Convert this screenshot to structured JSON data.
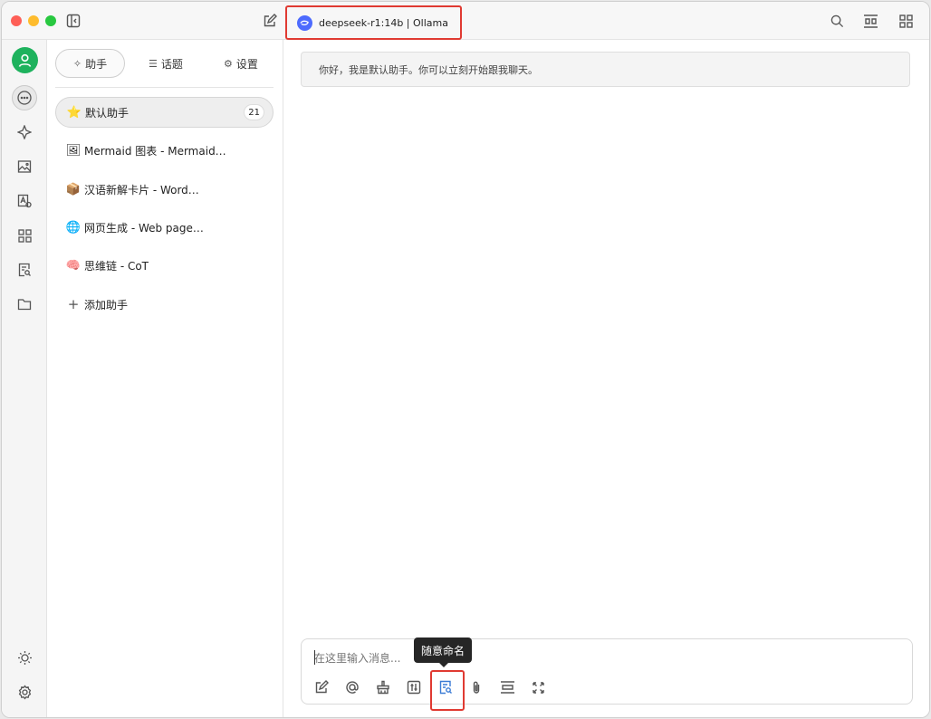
{
  "titlebar": {
    "model_label": "deepseek-r1:14b | Ollama",
    "icons": [
      "sidebar-toggle-icon",
      "new-chat-icon",
      "search-icon",
      "layout-icon",
      "apps-icon"
    ]
  },
  "rail": {
    "items": [
      "user-avatar",
      "chat-icon",
      "sparkle-icon",
      "image-icon",
      "translate-icon",
      "apps-icon",
      "document-search-icon",
      "folder-icon",
      "theme-icon",
      "settings-icon"
    ]
  },
  "panel": {
    "tabs": [
      {
        "label": "助手",
        "icon": "✧"
      },
      {
        "label": "话题",
        "icon": "☰"
      },
      {
        "label": "设置",
        "icon": "⚙"
      }
    ],
    "assistants": [
      {
        "emoji": "⭐",
        "label": "默认助手",
        "count": "21"
      },
      {
        "emoji": "🖼",
        "label": "Mermaid 图表 - Mermaid…"
      },
      {
        "emoji": "📦",
        "label": "汉语新解卡片 - Word…"
      },
      {
        "emoji": "🌐",
        "label": "网页生成 - Web page…"
      },
      {
        "emoji": "🧠",
        "label": "思维链 - CoT"
      }
    ],
    "add_label": "添加助手",
    "add_icon": "+"
  },
  "main": {
    "greeting": "你好，我是默认助手。你可以立刻开始跟我聊天。",
    "input_placeholder": "在这里输入消息...",
    "tooltip": "随意命名"
  },
  "colors": {
    "highlight": "#e03a32",
    "model_logo": "#4d6bfe",
    "avatar": "#1eb25d"
  }
}
